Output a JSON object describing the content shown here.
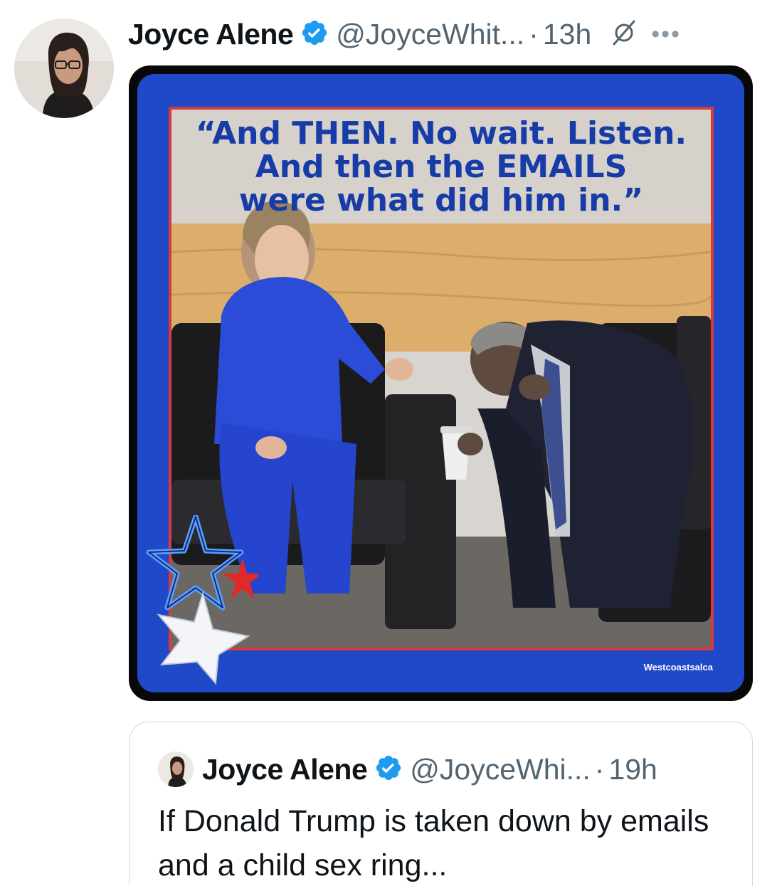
{
  "author": {
    "name": "Joyce Alene",
    "handle": "@JoyceWhit...",
    "dot": "·",
    "time": "13h"
  },
  "icons": {
    "verified": "verified-badge-icon",
    "grok": "grok-icon",
    "more": "more-icon"
  },
  "media": {
    "quote_lines": [
      "“And THEN. No wait. Listen.",
      "And then the EMAILS",
      "were what did him in.”"
    ],
    "watermark": "Westcoastsalca"
  },
  "quoted_tweet": {
    "name": "Joyce Alene",
    "handle": "@JoyceWhi...",
    "dot": "·",
    "time": "19h",
    "text": "If Donald Trump is taken down by emails and a child sex ring..."
  },
  "colors": {
    "verified_blue": "#1d9bf0",
    "meme_blue": "#1f49c9",
    "meme_text": "#173ca7",
    "meme_border_red": "#d83a3a",
    "secondary_text": "#536471"
  }
}
